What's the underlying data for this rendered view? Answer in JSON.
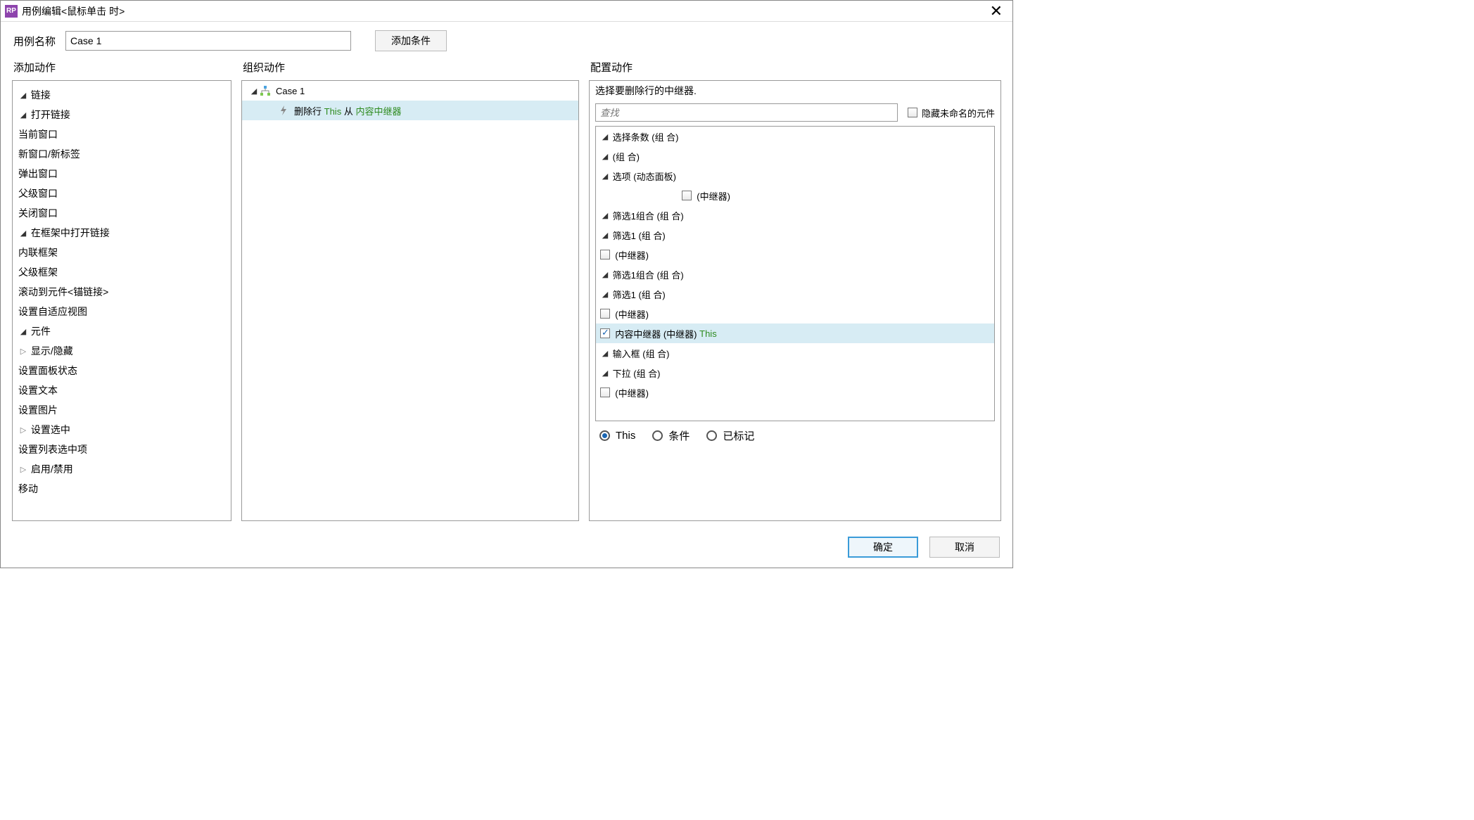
{
  "title": "用例编辑<鼠标单击 时>",
  "caseNameLabel": "用例名称",
  "caseName": "Case 1",
  "addCondBtn": "添加条件",
  "headers": {
    "addAction": "添加动作",
    "orgAction": "组织动作",
    "cfgAction": "配置动作"
  },
  "leftTree": {
    "links": "链接",
    "openLink": "打开链接",
    "curWin": "当前窗口",
    "newWin": "新窗口/新标签",
    "popWin": "弹出窗口",
    "parentWin": "父级窗口",
    "closeWin": "关闭窗口",
    "openInFrame": "在框架中打开链接",
    "inlineFrame": "内联框架",
    "parentFrame": "父级框架",
    "scrollTo": "滚动到元件<锚链接>",
    "setAdaptive": "设置自适应视图",
    "widgets": "元件",
    "showHide": "显示/隐藏",
    "setPanel": "设置面板状态",
    "setText": "设置文本",
    "setImage": "设置图片",
    "setSelected": "设置选中",
    "setListSel": "设置列表选中项",
    "enable": "启用/禁用",
    "move": "移动"
  },
  "mid": {
    "case": "Case 1",
    "action": "删除行",
    "thisWord": "This",
    "from": "从",
    "target": "内容中继器"
  },
  "right": {
    "hint": "选择要删除行的中继器.",
    "searchPlaceholder": "查找",
    "hideUnnamed": "隐藏未命名的元件",
    "g_selcount": "选择条数 (组 合)",
    "g_group": "(组 合)",
    "g_option": "选项 (动态面板)",
    "g_repeater": "(中继器)",
    "g_filt1grp": "筛选1组合 (组 合)",
    "g_filt1": "筛选1 (组 合)",
    "g_contentRep": "内容中继器 (中继器)",
    "g_this": "This",
    "g_input": "输入框 (组 合)",
    "g_dropdown": "下拉 (组 合)"
  },
  "radios": {
    "this": "This",
    "cond": "条件",
    "marked": "已标记"
  },
  "footer": {
    "ok": "确定",
    "cancel": "取消"
  }
}
